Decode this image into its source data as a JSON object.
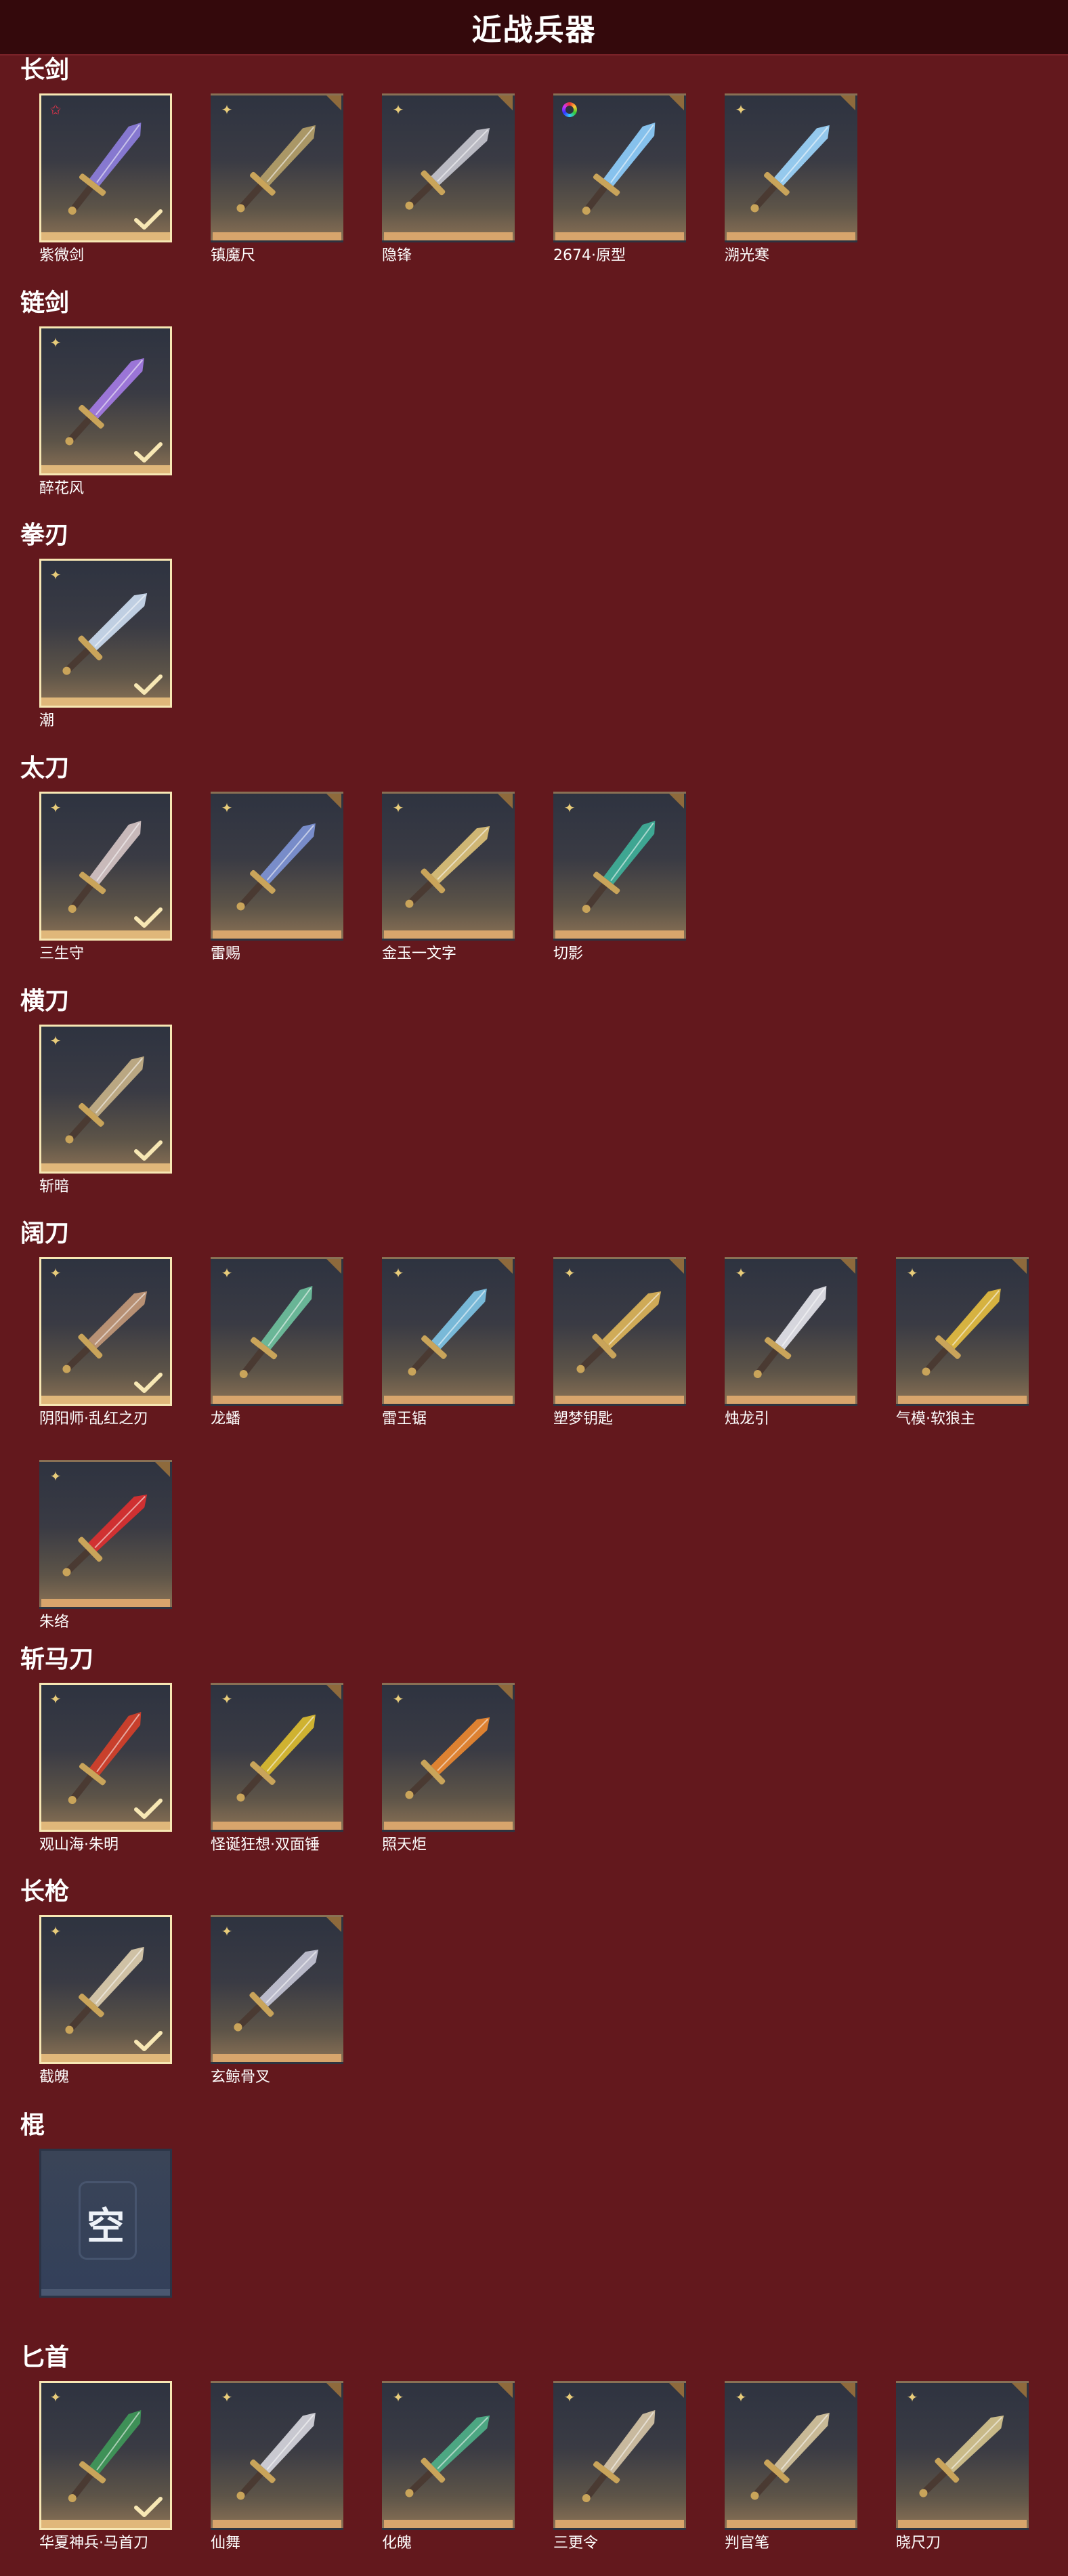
{
  "header": {
    "title": "近战兵器"
  },
  "sections": [
    {
      "title": "长剑",
      "items": [
        {
          "name": "紫微剑",
          "equipped": true,
          "rarity": "red-star",
          "color": "#8f7fe0"
        },
        {
          "name": "镇魔尺",
          "equipped": false,
          "rarity": "gold",
          "color": "#b7a26a"
        },
        {
          "name": "隐锋",
          "equipped": false,
          "rarity": "gold",
          "color": "#c9c9d2"
        },
        {
          "name": "2674·原型",
          "equipped": false,
          "rarity": "rainbow",
          "color": "#8fd0ff"
        },
        {
          "name": "溯光寒",
          "equipped": false,
          "rarity": "gold",
          "color": "#9fd8ff"
        }
      ]
    },
    {
      "title": "链剑",
      "items": [
        {
          "name": "醉花风",
          "equipped": true,
          "rarity": "gold",
          "color": "#a67ce8"
        }
      ]
    },
    {
      "title": "拳刃",
      "items": [
        {
          "name": "潮",
          "equipped": true,
          "rarity": "gold",
          "color": "#cfe0f4"
        }
      ]
    },
    {
      "title": "太刀",
      "items": [
        {
          "name": "三生守",
          "equipped": true,
          "rarity": "gold",
          "color": "#d8c8c8"
        },
        {
          "name": "雷赐",
          "equipped": false,
          "rarity": "gold",
          "color": "#7f96d8"
        },
        {
          "name": "金玉一文字",
          "equipped": false,
          "rarity": "gold",
          "color": "#e0c47a"
        },
        {
          "name": "切影",
          "equipped": false,
          "rarity": "gold",
          "color": "#3fb29b"
        }
      ]
    },
    {
      "title": "横刀",
      "items": [
        {
          "name": "斩暗",
          "equipped": true,
          "rarity": "gold",
          "color": "#c9b48a"
        }
      ]
    },
    {
      "title": "阔刀",
      "items": [
        {
          "name": "阴阳师·乱红之刃",
          "equipped": true,
          "rarity": "gold",
          "color": "#c59a7a"
        },
        {
          "name": "龙蟠",
          "equipped": false,
          "rarity": "gold",
          "color": "#6fc3a0"
        },
        {
          "name": "雷王锯",
          "equipped": false,
          "rarity": "gold",
          "color": "#7fc6e8"
        },
        {
          "name": "塑梦钥匙",
          "equipped": false,
          "rarity": "gold",
          "color": "#e0b75a"
        },
        {
          "name": "烛龙引",
          "equipped": false,
          "rarity": "gold",
          "color": "#e8e8ee"
        },
        {
          "name": "气模·软狼主",
          "equipped": false,
          "rarity": "gold",
          "color": "#e8c040"
        },
        {
          "name": "朱络",
          "equipped": false,
          "rarity": "gold",
          "color": "#e03030"
        }
      ]
    },
    {
      "title": "斩马刀",
      "items": [
        {
          "name": "观山海·朱明",
          "equipped": true,
          "rarity": "gold",
          "color": "#d8402a"
        },
        {
          "name": "怪诞狂想·双面锤",
          "equipped": false,
          "rarity": "gold",
          "color": "#e0c030"
        },
        {
          "name": "照天炬",
          "equipped": false,
          "rarity": "gold",
          "color": "#f08a30"
        }
      ]
    },
    {
      "title": "长枪",
      "items": [
        {
          "name": "截魄",
          "equipped": true,
          "rarity": "gold",
          "color": "#e0d0b0"
        },
        {
          "name": "玄鲸骨叉",
          "equipped": false,
          "rarity": "gold",
          "color": "#c8c8d8"
        }
      ]
    },
    {
      "title": "棍",
      "items": [],
      "empty_label": "空"
    },
    {
      "title": "匕首",
      "items": [
        {
          "name": "华夏神兵·马首刀",
          "equipped": true,
          "rarity": "gold",
          "color": "#3f9a5a"
        },
        {
          "name": "仙舞",
          "equipped": false,
          "rarity": "gold",
          "color": "#d8d8e0"
        },
        {
          "name": "化魄",
          "equipped": false,
          "rarity": "gold",
          "color": "#4fb28a"
        },
        {
          "name": "三更令",
          "equipped": false,
          "rarity": "gold",
          "color": "#d8c8a8"
        },
        {
          "name": "判官笔",
          "equipped": false,
          "rarity": "gold",
          "color": "#d8c8a0"
        },
        {
          "name": "晓尺刀",
          "equipped": false,
          "rarity": "gold",
          "color": "#d8c890"
        }
      ]
    }
  ],
  "colors": {
    "background": "#63181d",
    "header": "#34090c",
    "equipped_border": "#f7e7b4",
    "tile_bar": "#d8a56c"
  }
}
